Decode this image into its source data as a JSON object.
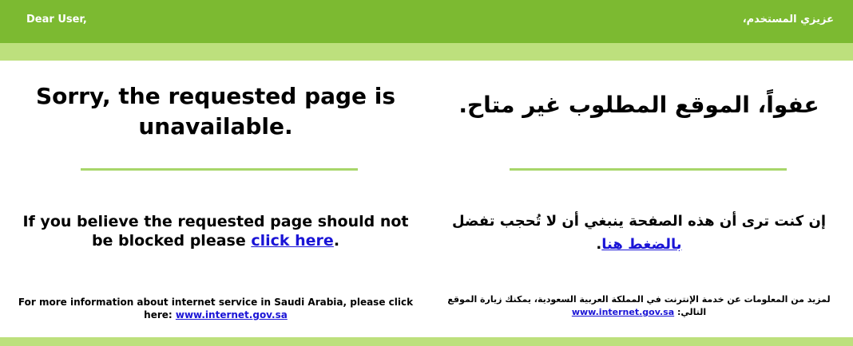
{
  "header": {
    "greeting_en": "Dear User,",
    "greeting_ar": "عزيزي المستخدم،"
  },
  "english": {
    "title": "Sorry, the requested page is unavailable.",
    "message_prefix": "If you believe the requested page should not be blocked please ",
    "message_link": "click here",
    "message_suffix": ".",
    "info_prefix": "For more information about internet service in Saudi Arabia, please click here: ",
    "info_link": "www.internet.gov.sa"
  },
  "arabic": {
    "title": "عفواً، الموقع المطلوب غير متاح.",
    "message_prefix": "إن كنت ترى أن هذه الصفحة ينبغي أن لا تُحجب تفضل ",
    "message_link": "بالضغط هنا",
    "message_suffix": ".",
    "info_prefix": "لمزيد من المعلومات عن خدمة الإنترنت في المملكة العربية السعودية، يمكنك زيارة الموقع التالي: ",
    "info_link": "www.internet.gov.sa"
  },
  "colors": {
    "header_green": "#7cba31",
    "band_light_green": "#bde07d",
    "divider_green": "#a8d66a",
    "link_blue": "#1a14d6"
  }
}
